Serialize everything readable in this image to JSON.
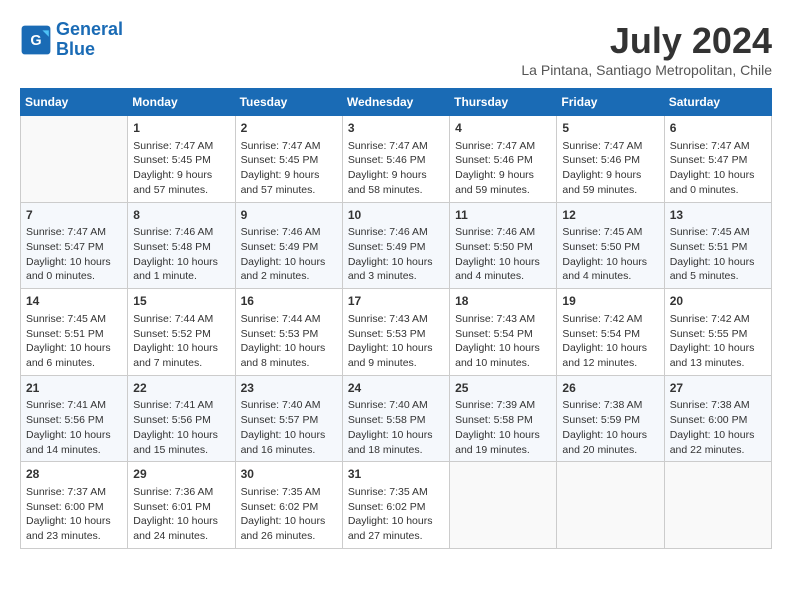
{
  "header": {
    "logo_line1": "General",
    "logo_line2": "Blue",
    "month_year": "July 2024",
    "location": "La Pintana, Santiago Metropolitan, Chile"
  },
  "days_of_week": [
    "Sunday",
    "Monday",
    "Tuesday",
    "Wednesday",
    "Thursday",
    "Friday",
    "Saturday"
  ],
  "weeks": [
    [
      {
        "day": "",
        "info": ""
      },
      {
        "day": "1",
        "info": "Sunrise: 7:47 AM\nSunset: 5:45 PM\nDaylight: 9 hours\nand 57 minutes."
      },
      {
        "day": "2",
        "info": "Sunrise: 7:47 AM\nSunset: 5:45 PM\nDaylight: 9 hours\nand 57 minutes."
      },
      {
        "day": "3",
        "info": "Sunrise: 7:47 AM\nSunset: 5:46 PM\nDaylight: 9 hours\nand 58 minutes."
      },
      {
        "day": "4",
        "info": "Sunrise: 7:47 AM\nSunset: 5:46 PM\nDaylight: 9 hours\nand 59 minutes."
      },
      {
        "day": "5",
        "info": "Sunrise: 7:47 AM\nSunset: 5:46 PM\nDaylight: 9 hours\nand 59 minutes."
      },
      {
        "day": "6",
        "info": "Sunrise: 7:47 AM\nSunset: 5:47 PM\nDaylight: 10 hours\nand 0 minutes."
      }
    ],
    [
      {
        "day": "7",
        "info": "Sunrise: 7:47 AM\nSunset: 5:47 PM\nDaylight: 10 hours\nand 0 minutes."
      },
      {
        "day": "8",
        "info": "Sunrise: 7:46 AM\nSunset: 5:48 PM\nDaylight: 10 hours\nand 1 minute."
      },
      {
        "day": "9",
        "info": "Sunrise: 7:46 AM\nSunset: 5:49 PM\nDaylight: 10 hours\nand 2 minutes."
      },
      {
        "day": "10",
        "info": "Sunrise: 7:46 AM\nSunset: 5:49 PM\nDaylight: 10 hours\nand 3 minutes."
      },
      {
        "day": "11",
        "info": "Sunrise: 7:46 AM\nSunset: 5:50 PM\nDaylight: 10 hours\nand 4 minutes."
      },
      {
        "day": "12",
        "info": "Sunrise: 7:45 AM\nSunset: 5:50 PM\nDaylight: 10 hours\nand 4 minutes."
      },
      {
        "day": "13",
        "info": "Sunrise: 7:45 AM\nSunset: 5:51 PM\nDaylight: 10 hours\nand 5 minutes."
      }
    ],
    [
      {
        "day": "14",
        "info": "Sunrise: 7:45 AM\nSunset: 5:51 PM\nDaylight: 10 hours\nand 6 minutes."
      },
      {
        "day": "15",
        "info": "Sunrise: 7:44 AM\nSunset: 5:52 PM\nDaylight: 10 hours\nand 7 minutes."
      },
      {
        "day": "16",
        "info": "Sunrise: 7:44 AM\nSunset: 5:53 PM\nDaylight: 10 hours\nand 8 minutes."
      },
      {
        "day": "17",
        "info": "Sunrise: 7:43 AM\nSunset: 5:53 PM\nDaylight: 10 hours\nand 9 minutes."
      },
      {
        "day": "18",
        "info": "Sunrise: 7:43 AM\nSunset: 5:54 PM\nDaylight: 10 hours\nand 10 minutes."
      },
      {
        "day": "19",
        "info": "Sunrise: 7:42 AM\nSunset: 5:54 PM\nDaylight: 10 hours\nand 12 minutes."
      },
      {
        "day": "20",
        "info": "Sunrise: 7:42 AM\nSunset: 5:55 PM\nDaylight: 10 hours\nand 13 minutes."
      }
    ],
    [
      {
        "day": "21",
        "info": "Sunrise: 7:41 AM\nSunset: 5:56 PM\nDaylight: 10 hours\nand 14 minutes."
      },
      {
        "day": "22",
        "info": "Sunrise: 7:41 AM\nSunset: 5:56 PM\nDaylight: 10 hours\nand 15 minutes."
      },
      {
        "day": "23",
        "info": "Sunrise: 7:40 AM\nSunset: 5:57 PM\nDaylight: 10 hours\nand 16 minutes."
      },
      {
        "day": "24",
        "info": "Sunrise: 7:40 AM\nSunset: 5:58 PM\nDaylight: 10 hours\nand 18 minutes."
      },
      {
        "day": "25",
        "info": "Sunrise: 7:39 AM\nSunset: 5:58 PM\nDaylight: 10 hours\nand 19 minutes."
      },
      {
        "day": "26",
        "info": "Sunrise: 7:38 AM\nSunset: 5:59 PM\nDaylight: 10 hours\nand 20 minutes."
      },
      {
        "day": "27",
        "info": "Sunrise: 7:38 AM\nSunset: 6:00 PM\nDaylight: 10 hours\nand 22 minutes."
      }
    ],
    [
      {
        "day": "28",
        "info": "Sunrise: 7:37 AM\nSunset: 6:00 PM\nDaylight: 10 hours\nand 23 minutes."
      },
      {
        "day": "29",
        "info": "Sunrise: 7:36 AM\nSunset: 6:01 PM\nDaylight: 10 hours\nand 24 minutes."
      },
      {
        "day": "30",
        "info": "Sunrise: 7:35 AM\nSunset: 6:02 PM\nDaylight: 10 hours\nand 26 minutes."
      },
      {
        "day": "31",
        "info": "Sunrise: 7:35 AM\nSunset: 6:02 PM\nDaylight: 10 hours\nand 27 minutes."
      },
      {
        "day": "",
        "info": ""
      },
      {
        "day": "",
        "info": ""
      },
      {
        "day": "",
        "info": ""
      }
    ]
  ]
}
